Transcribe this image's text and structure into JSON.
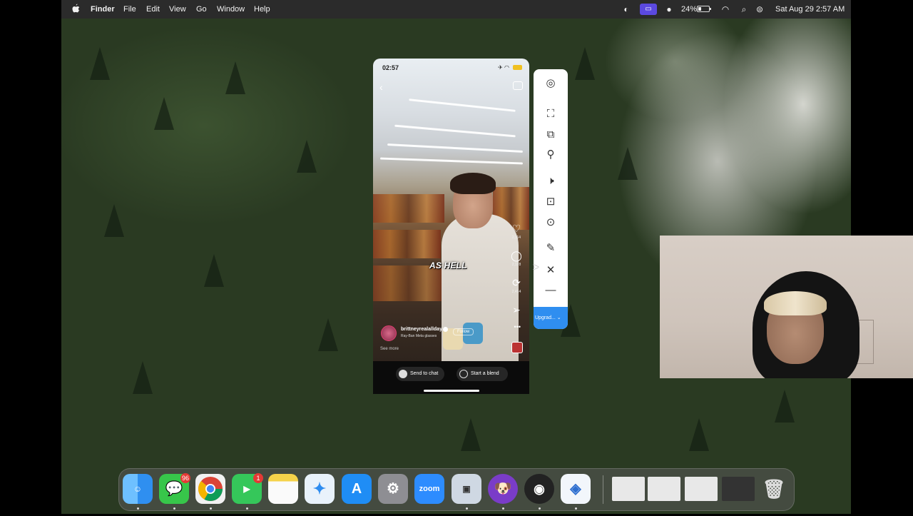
{
  "menubar": {
    "app_name": "Finder",
    "menus": [
      "File",
      "Edit",
      "View",
      "Go",
      "Window",
      "Help"
    ],
    "battery_percent": "24%",
    "datetime": "Sat Aug 29  2:57 AM"
  },
  "phone": {
    "status_time": "02:57",
    "caption": "AS HELL",
    "actions": [
      {
        "icon": "heart-icon",
        "count": "2,114"
      },
      {
        "icon": "comment-icon",
        "count": "2,178"
      },
      {
        "icon": "repost-icon",
        "count": "2,414"
      },
      {
        "icon": "share-icon",
        "count": ""
      }
    ],
    "username": "brittneyrealallday",
    "subline": "Ray-Ban Meta glasses",
    "follow_label": "Follow",
    "see_more": "See more",
    "send_to_chat": "Send to chat",
    "start_blend": "Start a blend"
  },
  "toolbar": {
    "icons": [
      "user-circle-icon",
      "fullscreen-icon",
      "picture-in-picture-icon",
      "pin-icon",
      "volume-icon",
      "camera-icon",
      "record-icon",
      "pen-icon",
      "close-icon",
      "minimize-icon"
    ],
    "upgrade_label": "Upgrad..."
  },
  "dock": {
    "apps": [
      {
        "name": "Finder",
        "color": "#2f8ff0"
      },
      {
        "name": "Messages",
        "color": "#37c64a",
        "badge": "96"
      },
      {
        "name": "Chrome",
        "color": "#e8e8e8"
      },
      {
        "name": "FaceTime",
        "color": "#35c75a",
        "badge": "1"
      },
      {
        "name": "Notes",
        "color": "#f5d24a"
      },
      {
        "name": "Safari",
        "color": "#2d8cf0"
      },
      {
        "name": "App Store",
        "color": "#1f8df5"
      },
      {
        "name": "System Settings",
        "color": "#8e8e93"
      },
      {
        "name": "zoom",
        "color": "#2d8cff"
      },
      {
        "name": "Preview",
        "color": "#cfd8e3"
      },
      {
        "name": "Dog App",
        "color": "#7a3cc8"
      },
      {
        "name": "OBS",
        "color": "#222222"
      },
      {
        "name": "Tool App",
        "color": "#f2f6fb"
      }
    ]
  }
}
